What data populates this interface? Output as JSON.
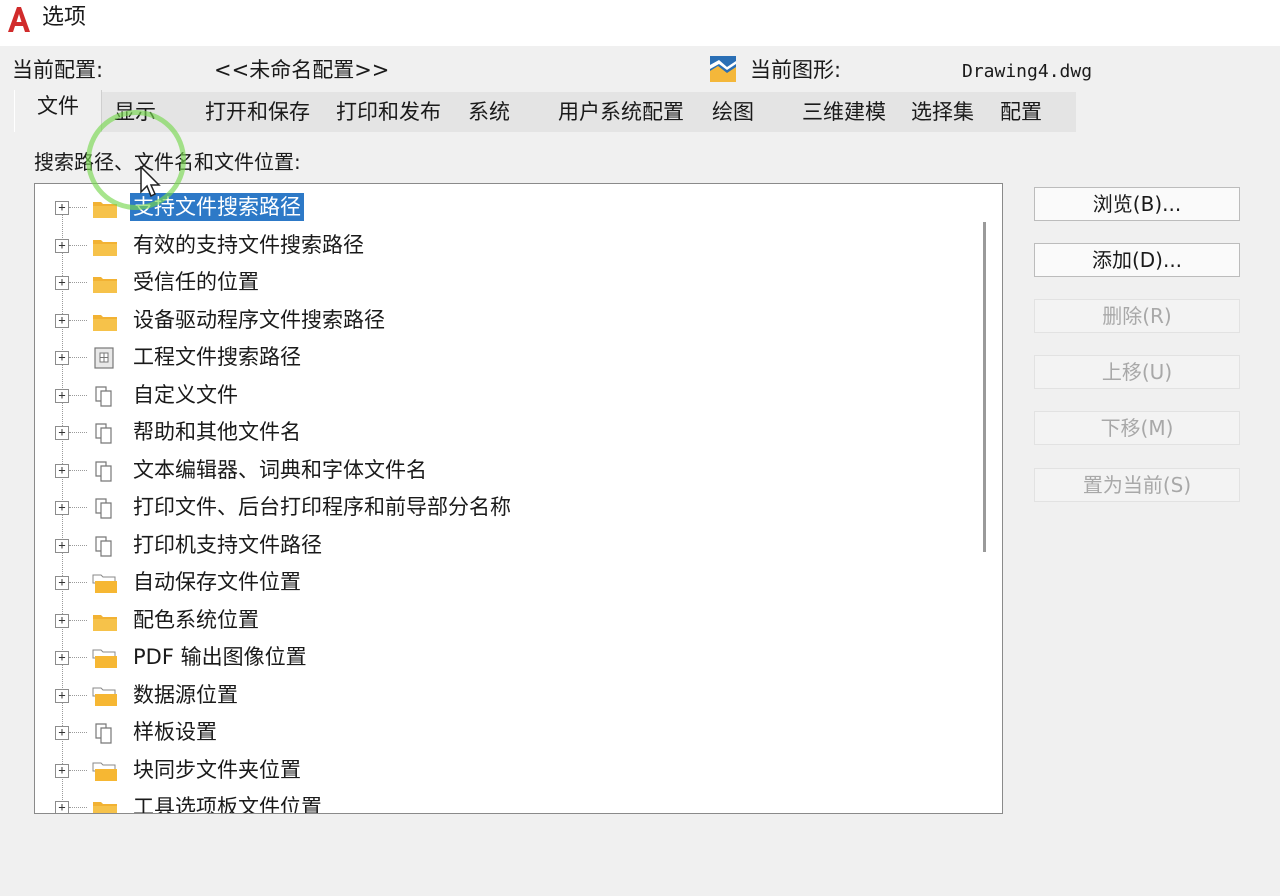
{
  "window": {
    "title": "选项",
    "logo_icon": "autocad-logo-icon",
    "brand_color": "#d12b2b"
  },
  "profile": {
    "current_profile_label": "当前配置:",
    "current_profile_value": "<<未命名配置>>",
    "current_drawing_label": "当前图形:",
    "current_drawing_value": "Drawing4.dwg",
    "drawing_icon": "drawing-file-icon"
  },
  "tabs": [
    {
      "label": "文件",
      "active": true
    },
    {
      "label": "显示"
    },
    {
      "label": "打开和保存"
    },
    {
      "label": "打印和发布"
    },
    {
      "label": "系统"
    },
    {
      "label": "用户系统配置"
    },
    {
      "label": "绘图"
    },
    {
      "label": "三维建模"
    },
    {
      "label": "选择集"
    },
    {
      "label": "配置"
    }
  ],
  "files": {
    "section_label": "搜索路径、文件名和文件位置:",
    "tree_items": [
      {
        "label": "支持文件搜索路径",
        "icon": "folder-icon",
        "selected": true
      },
      {
        "label": "有效的支持文件搜索路径",
        "icon": "folder-icon"
      },
      {
        "label": "受信任的位置",
        "icon": "folder-icon"
      },
      {
        "label": "设备驱动程序文件搜索路径",
        "icon": "folder-icon"
      },
      {
        "label": "工程文件搜索路径",
        "icon": "project-file-icon"
      },
      {
        "label": "自定义文件",
        "icon": "files-icon"
      },
      {
        "label": "帮助和其他文件名",
        "icon": "files-icon"
      },
      {
        "label": "文本编辑器、词典和字体文件名",
        "icon": "files-icon"
      },
      {
        "label": "打印文件、后台打印程序和前导部分名称",
        "icon": "files-icon"
      },
      {
        "label": "打印机支持文件路径",
        "icon": "files-icon"
      },
      {
        "label": "自动保存文件位置",
        "icon": "open-folder-icon"
      },
      {
        "label": "配色系统位置",
        "icon": "folder-icon"
      },
      {
        "label": "PDF 输出图像位置",
        "icon": "open-folder-icon"
      },
      {
        "label": "数据源位置",
        "icon": "open-folder-icon"
      },
      {
        "label": "样板设置",
        "icon": "files-icon"
      },
      {
        "label": "块同步文件夹位置",
        "icon": "open-folder-icon"
      },
      {
        "label": "工具选项板文件位置",
        "icon": "folder-icon"
      }
    ]
  },
  "buttons": {
    "browse": "浏览(B)...",
    "add": "添加(D)...",
    "remove": "删除(R)",
    "move_up": "上移(U)",
    "move_down": "下移(M)",
    "set_current": "置为当前(S)"
  },
  "colors": {
    "selection": "#2d79c7",
    "folder": "#f2b233",
    "highlight_ring": "#78d750"
  }
}
